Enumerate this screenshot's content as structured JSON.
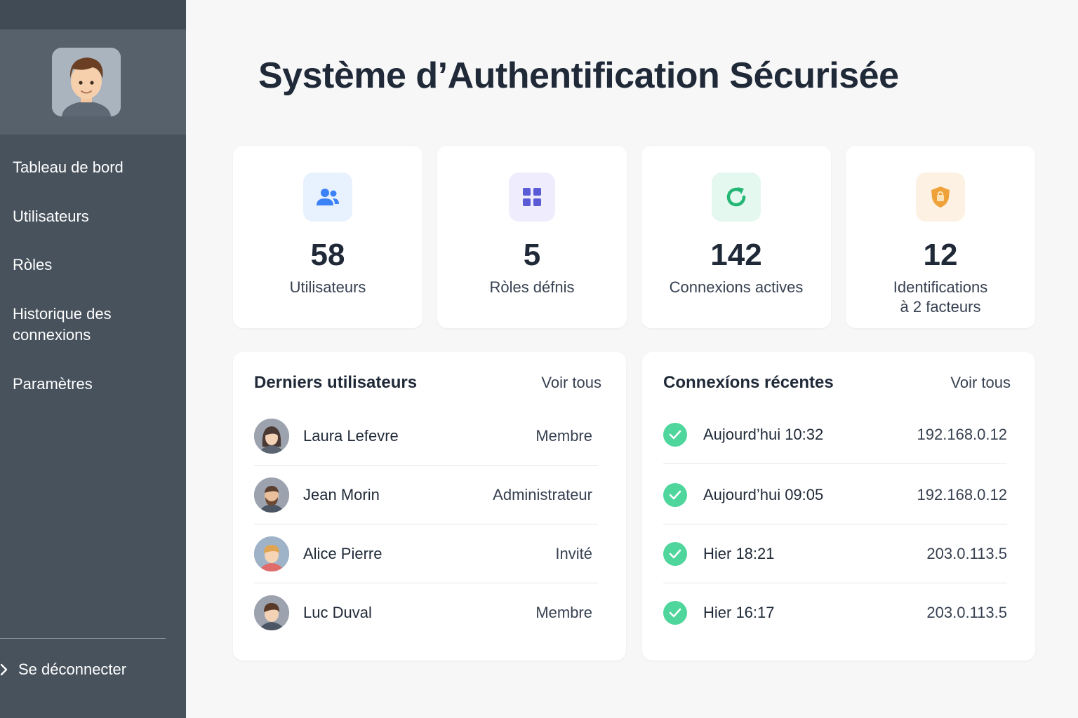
{
  "title": "Système d’Authentification Sécurisée",
  "sidebar": {
    "items": [
      {
        "label": "Tableau de bord"
      },
      {
        "label": "Utilisateurs"
      },
      {
        "label": "Ròles"
      },
      {
        "label": "Historique des connexions"
      },
      {
        "label": "Paramètres"
      }
    ],
    "logout_label": "Se déconnecter",
    "avatar_icon": "user-avatar-icon"
  },
  "stats": [
    {
      "value": "58",
      "label": "Utilisateurs",
      "icon": "users-icon",
      "color": "#3b82f6",
      "bg": "#e8f1fe"
    },
    {
      "value": "5",
      "label": "Ròles défnis",
      "icon": "grid-icon",
      "color": "#5b5bd6",
      "bg": "#efedfd"
    },
    {
      "value": "142",
      "label": "Connexions actives",
      "icon": "refresh-icon",
      "color": "#22b573",
      "bg": "#e4f8ef"
    },
    {
      "value": "12",
      "label_line1": "Identifications",
      "label_line2": "à 2 facteurs",
      "icon": "shield-icon",
      "color": "#f0a23a",
      "bg": "#fdf1e4"
    }
  ],
  "users_panel": {
    "title": "Derniers utilisateurs",
    "see_all": "Voir tous",
    "rows": [
      {
        "name": "Laura Lefevre",
        "role": "Membre"
      },
      {
        "name": "Jean Morin",
        "role": "Administrateur"
      },
      {
        "name": "Alice Pierre",
        "role": "Invité"
      },
      {
        "name": "Luc Duval",
        "role": "Membre"
      }
    ]
  },
  "connections_panel": {
    "title": "Connexíons récentes",
    "see_all": "Voir tous",
    "rows": [
      {
        "time": "Aujourd’hui 10:32",
        "ip": "192.168.0.12"
      },
      {
        "time": "Aujourd’hui 09:05",
        "ip": "192.168.0.12"
      },
      {
        "time": "Hier 18:21",
        "ip": "203.0.113.5"
      },
      {
        "time": "Hier 16:17",
        "ip": "203.0.113.5"
      }
    ]
  }
}
